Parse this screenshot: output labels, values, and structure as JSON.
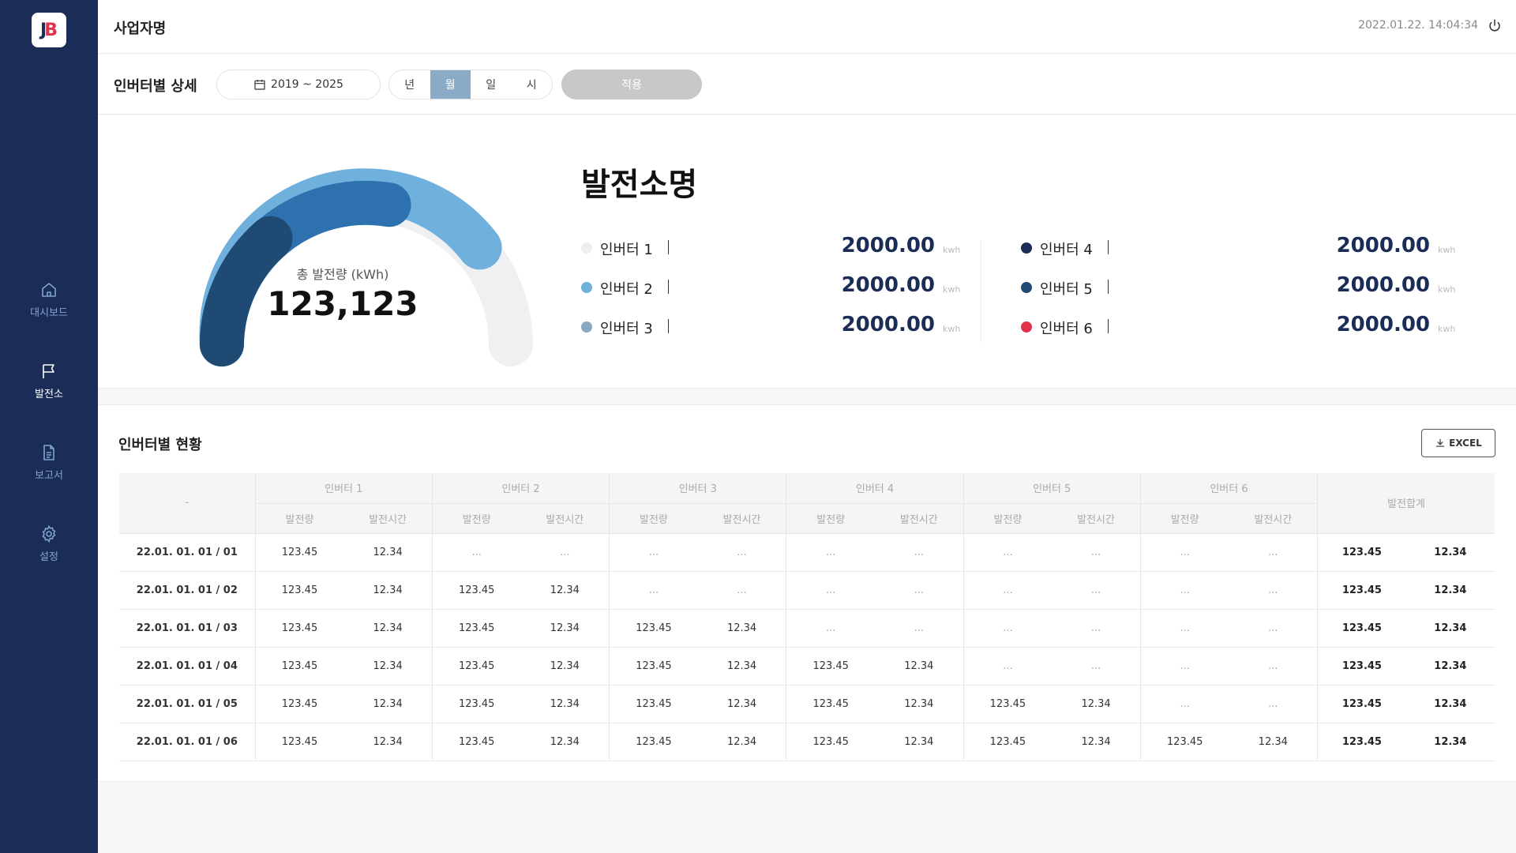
{
  "app": {
    "logo_left": "J",
    "logo_right": "B",
    "business_name": "사업자명",
    "datetime": "2022.01.22. 14:04:34"
  },
  "sidebar": {
    "items": [
      {
        "label": "대시보드",
        "icon": "home-icon"
      },
      {
        "label": "발전소",
        "icon": "flag-icon"
      },
      {
        "label": "보고서",
        "icon": "document-icon"
      },
      {
        "label": "설정",
        "icon": "gear-icon"
      }
    ]
  },
  "filter": {
    "title": "인버터별 상세",
    "date_range": "2019 ~ 2025",
    "periods": [
      "년",
      "월",
      "일",
      "시"
    ],
    "active_period": "월",
    "apply_label": "적용"
  },
  "summary": {
    "gauge_label": "총 발전량 (kWh)",
    "gauge_value": "123,123",
    "plant_name": "발전소명",
    "unit": "kwh",
    "inverters": [
      {
        "name": "인버터 1",
        "value": "2000.00",
        "color": "#eeeeee"
      },
      {
        "name": "인버터 2",
        "value": "2000.00",
        "color": "#6fb0dd"
      },
      {
        "name": "인버터 3",
        "value": "2000.00",
        "color": "#8aa7c3"
      },
      {
        "name": "인버터 4",
        "value": "2000.00",
        "color": "#1b2d56"
      },
      {
        "name": "인버터 5",
        "value": "2000.00",
        "color": "#234a74"
      },
      {
        "name": "인버터 6",
        "value": "2000.00",
        "color": "#e0324b"
      }
    ]
  },
  "table": {
    "title": "인버터별 현황",
    "excel_label": "EXCEL",
    "corner": "-",
    "groups": [
      "인버터 1",
      "인버터 2",
      "인버터 3",
      "인버터 4",
      "인버터 5",
      "인버터 6"
    ],
    "sub_headers": [
      "발전량",
      "발전시간"
    ],
    "sum_header": "발전합계",
    "rows": [
      {
        "date": "22.01. 01. 01  / 01",
        "cells": [
          "123.45",
          "12.34",
          "...",
          "...",
          "...",
          "...",
          "...",
          "...",
          "...",
          "...",
          "...",
          "..."
        ],
        "sum": [
          "123.45",
          "12.34"
        ]
      },
      {
        "date": "22.01. 01. 01  / 02",
        "cells": [
          "123.45",
          "12.34",
          "123.45",
          "12.34",
          "...",
          "...",
          "...",
          "...",
          "...",
          "...",
          "...",
          "..."
        ],
        "sum": [
          "123.45",
          "12.34"
        ]
      },
      {
        "date": "22.01. 01. 01  / 03",
        "cells": [
          "123.45",
          "12.34",
          "123.45",
          "12.34",
          "123.45",
          "12.34",
          "...",
          "...",
          "...",
          "...",
          "...",
          "..."
        ],
        "sum": [
          "123.45",
          "12.34"
        ]
      },
      {
        "date": "22.01. 01. 01  / 04",
        "cells": [
          "123.45",
          "12.34",
          "123.45",
          "12.34",
          "123.45",
          "12.34",
          "123.45",
          "12.34",
          "...",
          "...",
          "...",
          "..."
        ],
        "sum": [
          "123.45",
          "12.34"
        ]
      },
      {
        "date": "22.01. 01. 01  / 05",
        "cells": [
          "123.45",
          "12.34",
          "123.45",
          "12.34",
          "123.45",
          "12.34",
          "123.45",
          "12.34",
          "123.45",
          "12.34",
          "...",
          "..."
        ],
        "sum": [
          "123.45",
          "12.34"
        ]
      },
      {
        "date": "22.01. 01. 01  / 06",
        "cells": [
          "123.45",
          "12.34",
          "123.45",
          "12.34",
          "123.45",
          "12.34",
          "123.45",
          "12.34",
          "123.45",
          "12.34",
          "123.45",
          "12.34"
        ],
        "sum": [
          "123.45",
          "12.34"
        ]
      }
    ]
  }
}
